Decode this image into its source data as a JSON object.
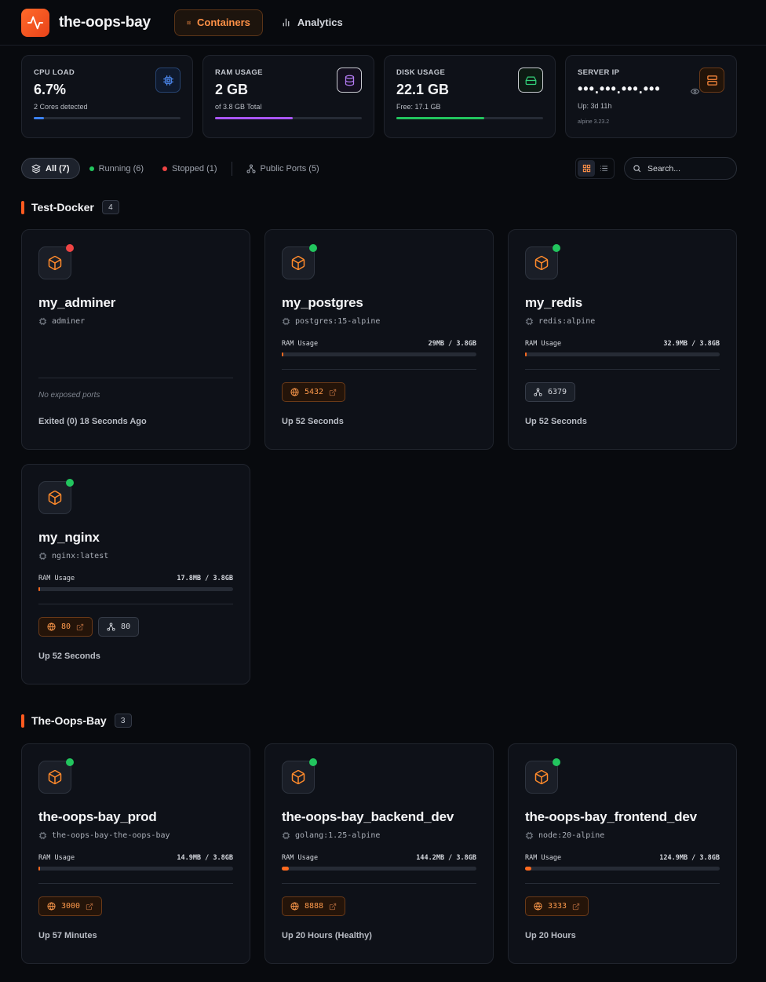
{
  "app": {
    "title": "the-oops-bay"
  },
  "nav": {
    "containers": "Containers",
    "analytics": "Analytics"
  },
  "stats": {
    "cpu": {
      "label": "CPU LOAD",
      "value": "6.7%",
      "sub": "2 Cores detected",
      "fill": 0.067,
      "color": "#3b82f6",
      "icon": "cpu-icon"
    },
    "ram": {
      "label": "RAM USAGE",
      "value": "2 GB",
      "sub": "of 3.8 GB Total",
      "fill": 0.53,
      "color": "#a855f7",
      "icon": "database-icon"
    },
    "disk": {
      "label": "DISK USAGE",
      "value": "22.1 GB",
      "sub": "Free: 17.1 GB",
      "fill": 0.6,
      "color": "#22c55e",
      "icon": "hard-drive-icon"
    },
    "server": {
      "label": "SERVER IP",
      "value": "•••.•••.•••.•••",
      "sub": "Up: 3d 11h",
      "os": "alpine 3.23.2",
      "icon": "server-icon"
    }
  },
  "filters": {
    "all": "All (7)",
    "running": "Running (6)",
    "stopped": "Stopped (1)",
    "ports": "Public Ports (5)"
  },
  "search": {
    "placeholder": "Search..."
  },
  "groups": [
    {
      "title": "Test-Docker",
      "count": "4",
      "cards": [
        {
          "name": "my_adminer",
          "image": "adminer",
          "status": "stopped",
          "ram_label": "",
          "ram_value": "",
          "ram_fill": 0,
          "no_ports": "No exposed ports",
          "ports": [],
          "uptime": "Exited (0) 18 Seconds Ago"
        },
        {
          "name": "my_postgres",
          "image": "postgres:15-alpine",
          "status": "running",
          "ram_label": "RAM Usage",
          "ram_value": "29MB / 3.8GB",
          "ram_fill": 0.008,
          "ports": [
            {
              "type": "public",
              "label": "5432"
            }
          ],
          "uptime": "Up 52 Seconds"
        },
        {
          "name": "my_redis",
          "image": "redis:alpine",
          "status": "running",
          "ram_label": "RAM Usage",
          "ram_value": "32.9MB / 3.8GB",
          "ram_fill": 0.009,
          "ports": [
            {
              "type": "internal",
              "label": "6379"
            }
          ],
          "uptime": "Up 52 Seconds"
        },
        {
          "name": "my_nginx",
          "image": "nginx:latest",
          "status": "running",
          "ram_label": "RAM Usage",
          "ram_value": "17.8MB / 3.8GB",
          "ram_fill": 0.005,
          "ports": [
            {
              "type": "public",
              "label": "80"
            },
            {
              "type": "internal",
              "label": "80"
            }
          ],
          "uptime": "Up 52 Seconds"
        }
      ]
    },
    {
      "title": "The-Oops-Bay",
      "count": "3",
      "cards": [
        {
          "name": "the-oops-bay_prod",
          "image": "the-oops-bay-the-oops-bay",
          "status": "running",
          "ram_label": "RAM Usage",
          "ram_value": "14.9MB / 3.8GB",
          "ram_fill": 0.004,
          "ports": [
            {
              "type": "public",
              "label": "3000"
            }
          ],
          "uptime": "Up 57 Minutes"
        },
        {
          "name": "the-oops-bay_backend_dev",
          "image": "golang:1.25-alpine",
          "status": "running",
          "ram_label": "RAM Usage",
          "ram_value": "144.2MB / 3.8GB",
          "ram_fill": 0.037,
          "ports": [
            {
              "type": "public",
              "label": "8888"
            }
          ],
          "uptime": "Up 20 Hours (Healthy)"
        },
        {
          "name": "the-oops-bay_frontend_dev",
          "image": "node:20-alpine",
          "status": "running",
          "ram_label": "RAM Usage",
          "ram_value": "124.9MB / 3.8GB",
          "ram_fill": 0.032,
          "ports": [
            {
              "type": "public",
              "label": "3333"
            }
          ],
          "uptime": "Up 20 Hours"
        }
      ]
    }
  ],
  "colors": {
    "accent": "#ff6a1f",
    "running": "#22c55e",
    "stopped": "#ef4444"
  }
}
